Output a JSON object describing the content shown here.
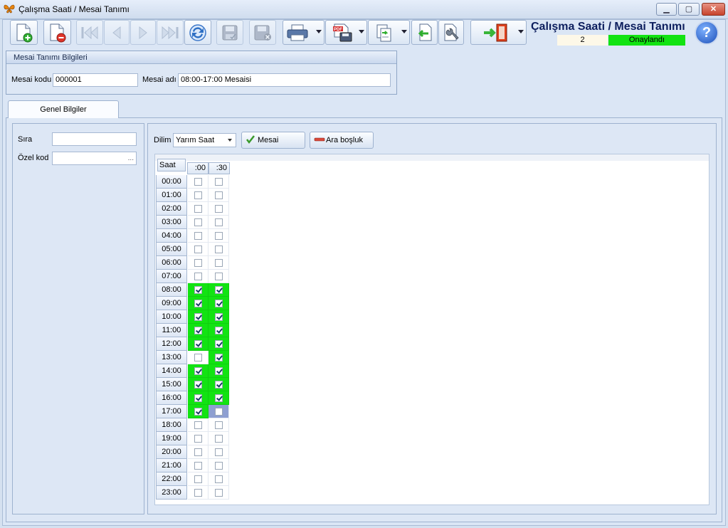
{
  "window": {
    "title": "Çalışma Saati / Mesai Tanımı",
    "app_icon": "butterfly-icon"
  },
  "toolbar": {
    "buttons": [
      {
        "name": "new-document-button",
        "icon": "new-document-icon"
      },
      {
        "name": "delete-document-button",
        "icon": "delete-document-icon"
      },
      {
        "name": "first-record-button",
        "icon": "first-icon",
        "disabled": true
      },
      {
        "name": "previous-record-button",
        "icon": "previous-icon",
        "disabled": true
      },
      {
        "name": "next-record-button",
        "icon": "next-icon",
        "disabled": true
      },
      {
        "name": "last-record-button",
        "icon": "last-icon",
        "disabled": true
      },
      {
        "name": "refresh-button",
        "icon": "refresh-icon"
      },
      {
        "name": "save-button",
        "icon": "save-icon",
        "disabled": true
      },
      {
        "name": "cancel-save-button",
        "icon": "save-cancel-icon",
        "disabled": true
      },
      {
        "name": "print-button",
        "icon": "printer-icon",
        "dropdown": true
      },
      {
        "name": "pdf-export-button",
        "icon": "pdf-icon",
        "dropdown": true
      },
      {
        "name": "export-button",
        "icon": "export-icon",
        "dropdown": true
      },
      {
        "name": "import-button",
        "icon": "import-icon"
      },
      {
        "name": "tools-button",
        "icon": "wrench-icon"
      },
      {
        "name": "exit-button",
        "icon": "exit-door-icon",
        "dropdown": true
      }
    ]
  },
  "header": {
    "title": "Çalışma Saati / Mesai Tanımı",
    "record_count": "2",
    "status": "Onaylandı",
    "status_color": "#12e312",
    "help_label": "?"
  },
  "mesai_info": {
    "group_title": "Mesai Tanımı Bilgileri",
    "code_label": "Mesai kodu",
    "code_value": "000001",
    "name_label": "Mesai adı",
    "name_value": "08:00-17:00 Mesaisi"
  },
  "tabs": [
    {
      "label": "Genel Bilgiler",
      "active": true
    }
  ],
  "general": {
    "sira_label": "Sıra",
    "sira_value": "",
    "ozel_kod_label": "Özel kod",
    "ozel_kod_value": "",
    "ellipsis": "..."
  },
  "schedule": {
    "dilim_label": "Dilim",
    "dilim_value": "Yarım Saat",
    "mesai_button": "Mesai",
    "ara_bosluk_button": "Ara boşluk",
    "corner_label": "Saat",
    "columns": [
      ":00",
      ":30"
    ],
    "active_color": "#12e312",
    "rows": [
      {
        "hour": "00:00",
        "c00": false,
        "c30": false
      },
      {
        "hour": "01:00",
        "c00": false,
        "c30": false
      },
      {
        "hour": "02:00",
        "c00": false,
        "c30": false
      },
      {
        "hour": "03:00",
        "c00": false,
        "c30": false
      },
      {
        "hour": "04:00",
        "c00": false,
        "c30": false
      },
      {
        "hour": "05:00",
        "c00": false,
        "c30": false
      },
      {
        "hour": "06:00",
        "c00": false,
        "c30": false
      },
      {
        "hour": "07:00",
        "c00": false,
        "c30": false
      },
      {
        "hour": "08:00",
        "c00": true,
        "c30": true
      },
      {
        "hour": "09:00",
        "c00": true,
        "c30": true
      },
      {
        "hour": "10:00",
        "c00": true,
        "c30": true
      },
      {
        "hour": "11:00",
        "c00": true,
        "c30": true
      },
      {
        "hour": "12:00",
        "c00": true,
        "c30": true
      },
      {
        "hour": "13:00",
        "c00": false,
        "c30": true
      },
      {
        "hour": "14:00",
        "c00": true,
        "c30": true
      },
      {
        "hour": "15:00",
        "c00": true,
        "c30": true
      },
      {
        "hour": "16:00",
        "c00": true,
        "c30": true
      },
      {
        "hour": "17:00",
        "c00": true,
        "c30": false,
        "c30_selected": true
      },
      {
        "hour": "18:00",
        "c00": false,
        "c30": false
      },
      {
        "hour": "19:00",
        "c00": false,
        "c30": false
      },
      {
        "hour": "20:00",
        "c00": false,
        "c30": false
      },
      {
        "hour": "21:00",
        "c00": false,
        "c30": false
      },
      {
        "hour": "22:00",
        "c00": false,
        "c30": false
      },
      {
        "hour": "23:00",
        "c00": false,
        "c30": false
      }
    ]
  }
}
